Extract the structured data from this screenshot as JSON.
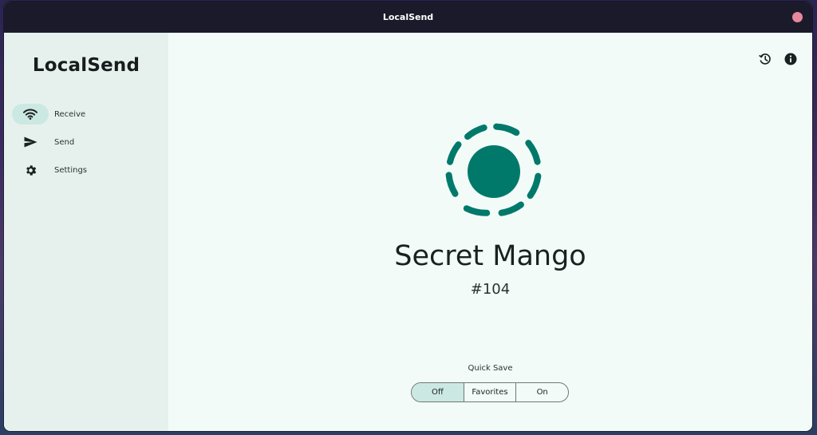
{
  "window": {
    "title": "LocalSend"
  },
  "sidebar": {
    "app_name": "LocalSend",
    "items": [
      {
        "label": "Receive",
        "icon": "wifi-icon",
        "active": true
      },
      {
        "label": "Send",
        "icon": "send-icon",
        "active": false
      },
      {
        "label": "Settings",
        "icon": "gear-icon",
        "active": false
      }
    ]
  },
  "header": {
    "actions": [
      {
        "icon": "history-icon"
      },
      {
        "icon": "info-icon"
      }
    ]
  },
  "device": {
    "name": "Secret Mango",
    "id": "#104"
  },
  "quick_save": {
    "label": "Quick Save",
    "options": [
      "Off",
      "Favorites",
      "On"
    ],
    "selected": "Off"
  },
  "colors": {
    "accent": "#00796b",
    "selected_bg": "#cce8e2",
    "sidebar_bg": "#e6f1ee",
    "content_bg": "#f2fbf8",
    "titlebar_bg": "#1b1a2b",
    "close_button": "#e8879c"
  }
}
